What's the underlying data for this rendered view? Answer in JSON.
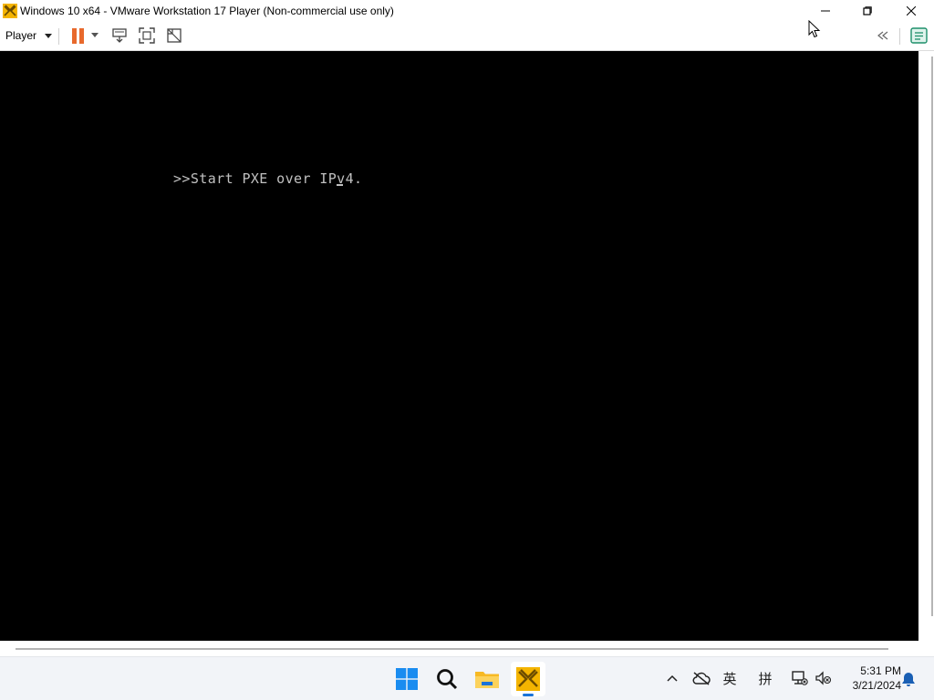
{
  "window": {
    "title": "Windows 10 x64 - VMware Workstation 17 Player (Non-commercial use only)",
    "controls": [
      "minimize",
      "restore",
      "close"
    ]
  },
  "toolbar": {
    "player_menu": "Player",
    "icons": [
      "pause-icon",
      "send-ctrl-alt-del-icon",
      "fit-guest-icon",
      "unity-icon",
      "collapse-icon",
      "notes-icon"
    ],
    "accent": "#e8692c"
  },
  "vm_console": {
    "line": ">>Start PXE over IPv4.",
    "background": "#000000",
    "text_color": "#c0c0c0"
  },
  "taskbar": {
    "apps": [
      "start-icon",
      "search-icon",
      "file-explorer-icon",
      "vmware-player-icon"
    ],
    "tray": {
      "lang_primary": "英",
      "lang_secondary": "拼"
    },
    "clock": {
      "time": "5:31 PM",
      "date": "3/21/2024"
    },
    "indicator_color": "#1a73d9"
  }
}
